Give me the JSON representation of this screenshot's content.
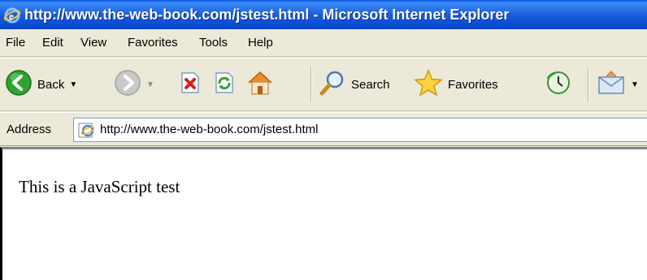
{
  "window": {
    "title": "http://www.the-web-book.com/jstest.html - Microsoft Internet Explorer"
  },
  "menubar": {
    "items": [
      {
        "label": "File"
      },
      {
        "label": "Edit"
      },
      {
        "label": "View"
      },
      {
        "label": "Favorites"
      },
      {
        "label": "Tools"
      },
      {
        "label": "Help"
      }
    ]
  },
  "toolbar": {
    "back_label": "Back",
    "search_label": "Search",
    "favorites_label": "Favorites",
    "icons": [
      "back-icon",
      "forward-icon",
      "stop-icon",
      "refresh-icon",
      "home-icon",
      "search-icon",
      "favorites-icon",
      "history-icon",
      "mail-icon"
    ]
  },
  "address": {
    "label": "Address",
    "url": "http://www.the-web-book.com/jstest.html"
  },
  "page": {
    "text": "This is a JavaScript test"
  },
  "colors": {
    "titlebar": "#0b4fd4",
    "chrome": "#ece9d8",
    "back_green": "#2fa32f",
    "stop_red": "#d42020"
  }
}
